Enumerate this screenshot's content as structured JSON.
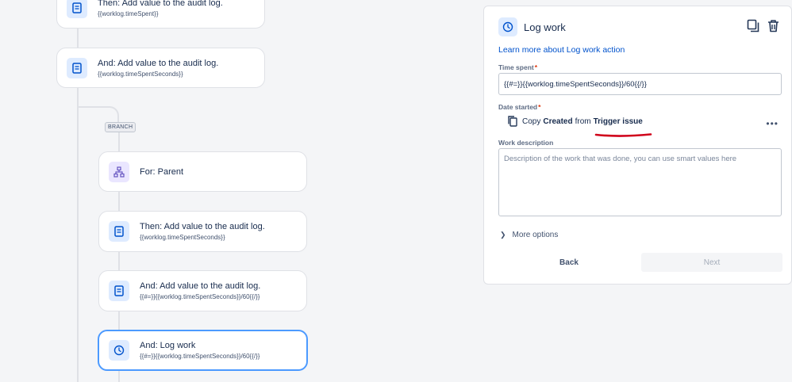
{
  "flow": {
    "cards": [
      {
        "title": "Then: Add value to the audit log.",
        "sub": "{{worklog.timeSpent}}",
        "icon": "audit-log-icon"
      },
      {
        "title": "And: Add value to the audit log.",
        "sub": "{{worklog.timeSpentSeconds}}",
        "icon": "audit-log-icon"
      },
      {
        "title": "For: Parent",
        "sub": "",
        "icon": "branch-icon"
      },
      {
        "title": "Then: Add value to the audit log.",
        "sub": "{{worklog.timeSpentSeconds}}",
        "icon": "audit-log-icon"
      },
      {
        "title": "And: Add value to the audit log.",
        "sub": "{{#=}}{{worklog.timeSpentSeconds}}/60{{/}}",
        "icon": "audit-log-icon"
      },
      {
        "title": "And: Log work",
        "sub": "{{#=}}{{worklog.timeSpentSeconds}}/60{{/}}",
        "icon": "clock-icon",
        "selected": true
      }
    ],
    "branch_label": "BRANCH"
  },
  "panel": {
    "title": "Log work",
    "learn_link": "Learn more about Log work action",
    "time_spent_label": "Time spent",
    "time_spent_value": "{{#=}}{{worklog.timeSpentSeconds}}/60{{/}}",
    "date_started_label": "Date started",
    "copy_prefix": "Copy",
    "copy_field": "Created",
    "copy_from": "from",
    "copy_source": "Trigger issue",
    "more_menu": "•••",
    "work_description_label": "Work description",
    "work_description_placeholder": "Description of the work that was done, you can use smart values here",
    "more_options": "More options",
    "back_label": "Back",
    "next_label": "Next"
  },
  "colors": {
    "accent": "#0052cc",
    "selected_border": "#4c9aff",
    "annotation_red": "#d0021b",
    "required": "#de350b"
  }
}
